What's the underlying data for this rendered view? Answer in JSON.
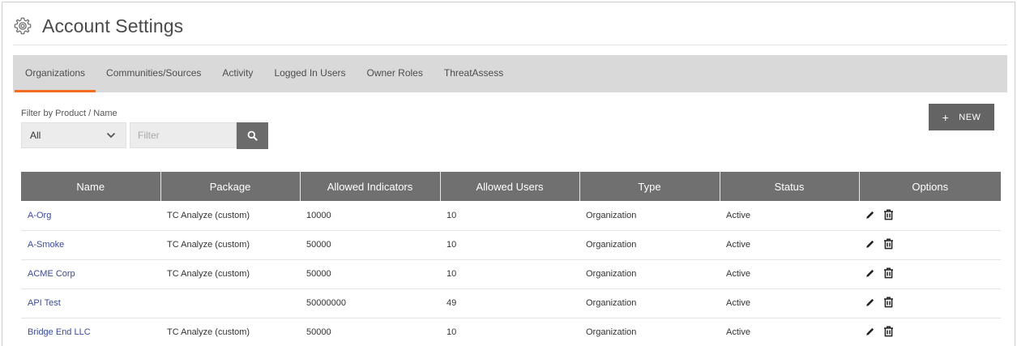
{
  "header": {
    "title": "Account Settings",
    "icon": "gear-icon"
  },
  "tabs": [
    {
      "label": "Organizations",
      "active": true
    },
    {
      "label": "Communities/Sources",
      "active": false
    },
    {
      "label": "Activity",
      "active": false
    },
    {
      "label": "Logged In Users",
      "active": false
    },
    {
      "label": "Owner Roles",
      "active": false
    },
    {
      "label": "ThreatAssess",
      "active": false
    }
  ],
  "filter": {
    "label": "Filter by Product / Name",
    "select_value": "All",
    "input_value": "",
    "input_placeholder": "Filter"
  },
  "toolbar": {
    "new_label": "NEW",
    "new_plus": "+"
  },
  "table": {
    "columns": [
      "Name",
      "Package",
      "Allowed Indicators",
      "Allowed Users",
      "Type",
      "Status",
      "Options"
    ],
    "rows": [
      {
        "name": "A-Org",
        "package": "TC Analyze (custom)",
        "indicators": "10000",
        "users": "10",
        "type": "Organization",
        "status": "Active"
      },
      {
        "name": "A-Smoke",
        "package": "TC Analyze (custom)",
        "indicators": "50000",
        "users": "10",
        "type": "Organization",
        "status": "Active"
      },
      {
        "name": "ACME Corp",
        "package": "TC Analyze (custom)",
        "indicators": "50000",
        "users": "10",
        "type": "Organization",
        "status": "Active"
      },
      {
        "name": "API Test",
        "package": "",
        "indicators": "50000000",
        "users": "49",
        "type": "Organization",
        "status": "Active"
      },
      {
        "name": "Bridge End LLC",
        "package": "TC Analyze (custom)",
        "indicators": "50000",
        "users": "10",
        "type": "Organization",
        "status": "Active"
      }
    ]
  },
  "colors": {
    "accent": "#f26d21",
    "link": "#3a4a9f",
    "header_bg": "#707070",
    "tab_bar_bg": "#d9d9d9"
  }
}
